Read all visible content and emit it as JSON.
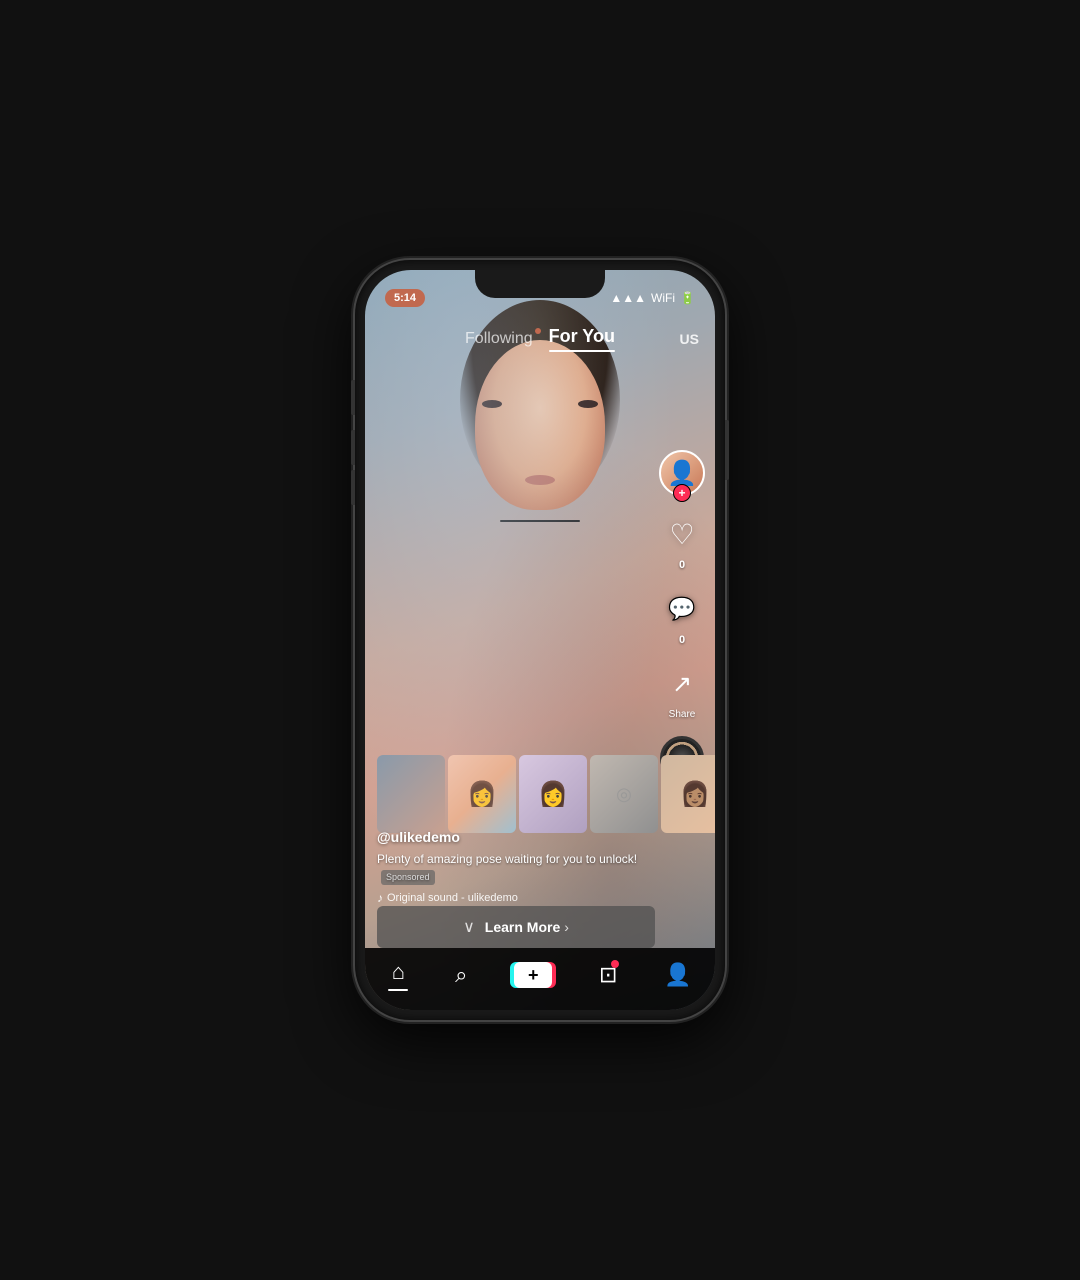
{
  "phone": {
    "status": {
      "time": "5:14"
    },
    "nav": {
      "following": "Following",
      "foryou": "For You",
      "region": "US"
    },
    "video": {
      "username": "@ulikedemo",
      "description": "Plenty of amazing pose waiting for you to unlock!",
      "sponsored_label": "Sponsored",
      "sound": "Original sound - ulikedemo",
      "like_count": "0",
      "comment_count": "0",
      "share_label": "Share"
    },
    "cta": {
      "learn_more": "Learn More",
      "arrow": "›"
    },
    "bottom_nav": {
      "home": "Home",
      "search": "Search",
      "inbox": "Inbox",
      "profile": "Profile"
    }
  }
}
